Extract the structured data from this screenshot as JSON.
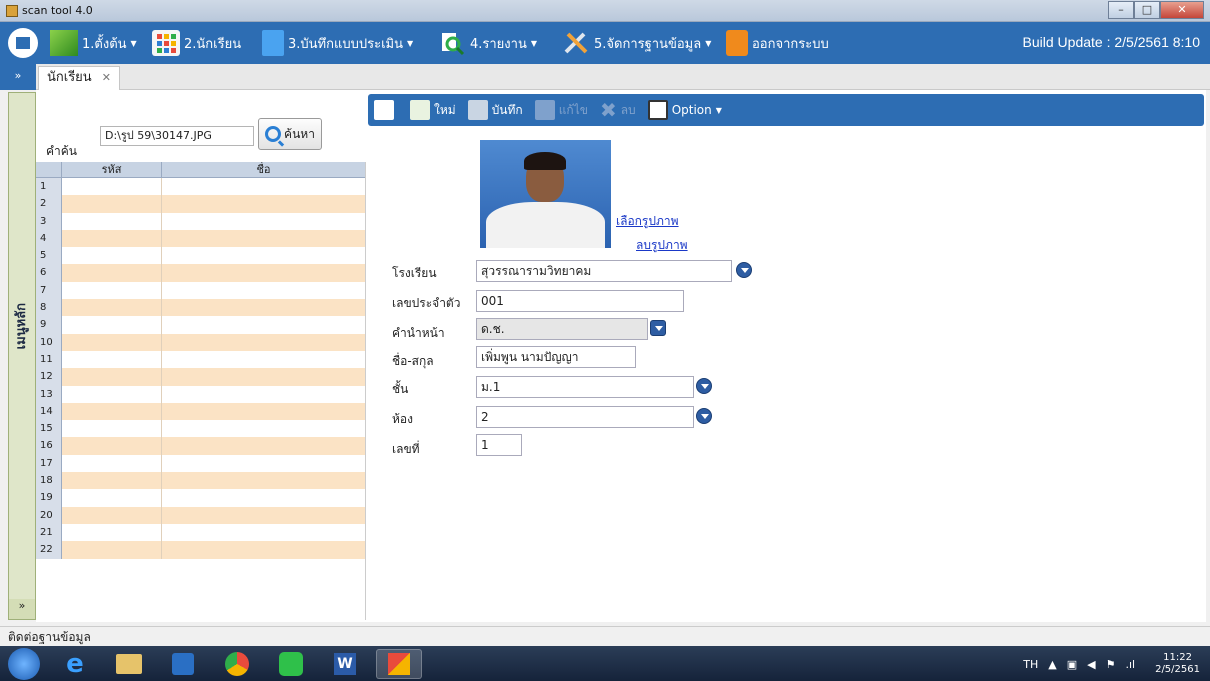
{
  "window": {
    "title": "scan tool 4.0"
  },
  "menu": {
    "items": [
      {
        "label": "1.ตั้งต้น",
        "has_dropdown": true
      },
      {
        "label": "2.นักเรียน",
        "has_dropdown": false
      },
      {
        "label": "3.บันทึกแบบประเมิน",
        "has_dropdown": true
      },
      {
        "label": "4.รายงาน",
        "has_dropdown": true
      },
      {
        "label": "5.จัดการฐานข้อมูล",
        "has_dropdown": true
      },
      {
        "label": "ออกจากระบบ",
        "has_dropdown": false
      }
    ],
    "build": "Build Update : 2/5/2561  8:10"
  },
  "tab": {
    "label": "นักเรียน"
  },
  "sidebar": {
    "label": "เมนูหลัก"
  },
  "search": {
    "label": "คำค้น",
    "value": "D:\\รูป 59\\30147.JPG",
    "button": "ค้นหา"
  },
  "grid": {
    "headers": [
      "รหัส",
      "ชื่อ"
    ],
    "rows": [
      "1",
      "2",
      "3",
      "4",
      "5",
      "6",
      "7",
      "8",
      "9",
      "10",
      "11",
      "12",
      "13",
      "14",
      "15",
      "16",
      "17",
      "18",
      "19",
      "20",
      "21",
      "22"
    ]
  },
  "toolbar": {
    "new": "ใหม่",
    "save": "บันทึก",
    "edit": "แก้ไข",
    "delete": "ลบ",
    "option": "Option"
  },
  "photo": {
    "select_link": "เลือกรูปภาพ",
    "delete_link": "ลบรูปภาพ"
  },
  "form": {
    "school": {
      "label": "โรงเรียน",
      "value": "สุวรรณารามวิทยาคม"
    },
    "student_id": {
      "label": "เลขประจำตัว",
      "value": "001"
    },
    "prefix": {
      "label": "คำนำหน้า",
      "value": "ด.ช."
    },
    "fullname": {
      "label": "ชื่อ-สกุล",
      "value": "เพิ่มพูน นามปัญญา"
    },
    "grade": {
      "label": "ชั้น",
      "value": "ม.1"
    },
    "room": {
      "label": "ห้อง",
      "value": "2"
    },
    "number": {
      "label": "เลขที่",
      "value": "1"
    }
  },
  "status": {
    "text": "ติดต่อฐานข้อมูล"
  },
  "taskbar": {
    "lang": "TH",
    "time": "11:22",
    "date": "2/5/2561"
  }
}
